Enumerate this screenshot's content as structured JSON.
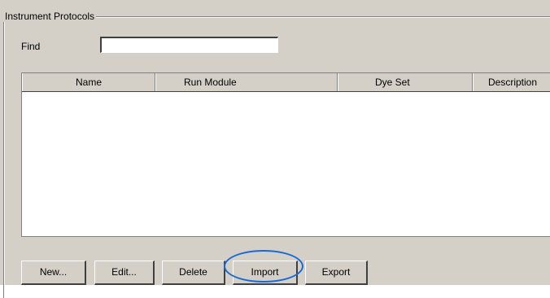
{
  "group": {
    "title": "Instrument Protocols"
  },
  "find": {
    "label": "Find",
    "value": "",
    "placeholder": ""
  },
  "table": {
    "columns": [
      "Name",
      "Run Module",
      "Dye Set",
      "Description"
    ],
    "rows": []
  },
  "buttons": {
    "new_label": "New...",
    "edit_label": "Edit...",
    "delete_label": "Delete",
    "import_label": "Import",
    "export_label": "Export"
  },
  "highlight": {
    "target": "import-button",
    "color": "#1569d6"
  },
  "colors": {
    "panel_bg": "#d4d0c8"
  }
}
